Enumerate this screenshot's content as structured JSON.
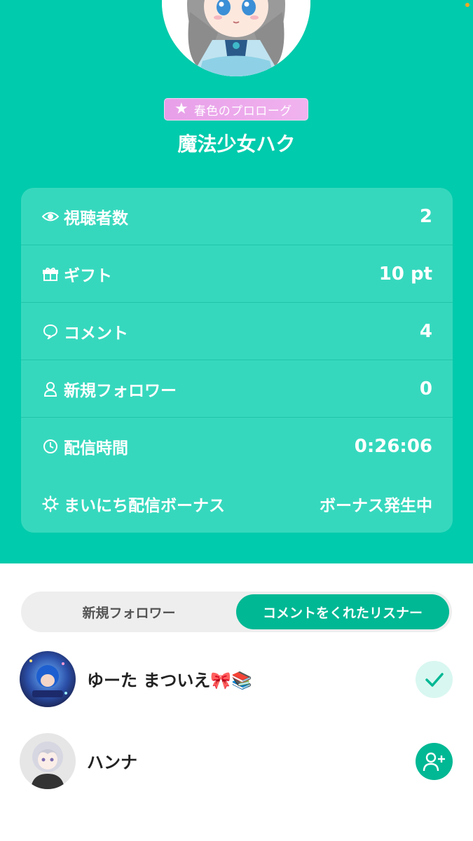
{
  "profile": {
    "badge": "春色のプロローグ",
    "name": "魔法少女ハク"
  },
  "stats": [
    {
      "icon": "eye-icon",
      "label": "視聴者数",
      "value": "2"
    },
    {
      "icon": "gift-icon",
      "label": "ギフト",
      "value": "10 pt"
    },
    {
      "icon": "comment-bubble-icon",
      "label": "コメント",
      "value": "4"
    },
    {
      "icon": "person-icon",
      "label": "新規フォロワー",
      "value": "0"
    },
    {
      "icon": "clock-icon",
      "label": "配信時間",
      "value": "0:26:06"
    },
    {
      "icon": "sun-icon",
      "label": "まいにち配信ボーナス",
      "value": "ボーナス発生中"
    }
  ],
  "tabs": {
    "new_followers": "新規フォロワー",
    "commenters": "コメントをくれたリスナー",
    "active": "commenters"
  },
  "listeners": [
    {
      "name": "ゆーた まついえ🎀📚",
      "following": true
    },
    {
      "name": "ハンナ",
      "following": false
    }
  ],
  "colors": {
    "header_bg": "#00cbac",
    "card_bg": "#36d8bd",
    "accent": "#00b894"
  }
}
